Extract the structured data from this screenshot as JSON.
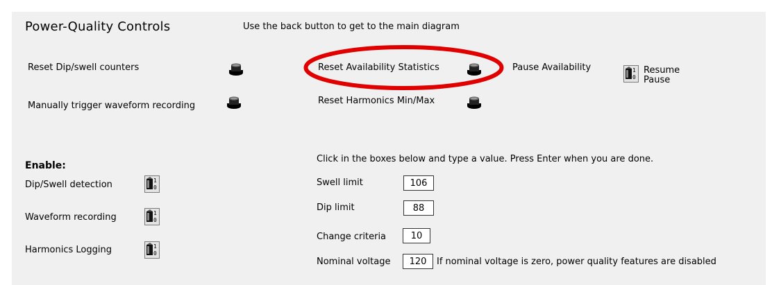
{
  "header": {
    "title": "Power-Quality Controls",
    "hint": "Use the back button to get to the main diagram"
  },
  "actions": {
    "reset_dip_swell": "Reset Dip/swell counters",
    "manual_trigger": "Manually trigger waveform recording",
    "reset_availability": "Reset Availability Statistics",
    "reset_harmonics": "Reset Harmonics Min/Max",
    "pause_availability": "Pause Availability"
  },
  "availability_toggle": {
    "on_label": "Resume",
    "off_label": "Pause"
  },
  "toggle_marks": {
    "on": "1",
    "off": "0"
  },
  "enable": {
    "heading": "Enable:",
    "items": [
      {
        "label": "Dip/Swell detection"
      },
      {
        "label": "Waveform recording"
      },
      {
        "label": "Harmonics Logging"
      }
    ]
  },
  "settings": {
    "instruction": "Click in the boxes below and type a value. Press Enter when you are done.",
    "swell_limit": {
      "label": "Swell limit",
      "value": "106"
    },
    "dip_limit": {
      "label": "Dip limit",
      "value": "88"
    },
    "change_criteria": {
      "label": "Change criteria",
      "value": "10"
    },
    "nominal_voltage": {
      "label": "Nominal voltage",
      "value": "120"
    },
    "nominal_note": "If nominal voltage is zero, power quality features are disabled"
  },
  "colors": {
    "panel_bg": "#f0f0f0",
    "highlight": "#e00000"
  }
}
